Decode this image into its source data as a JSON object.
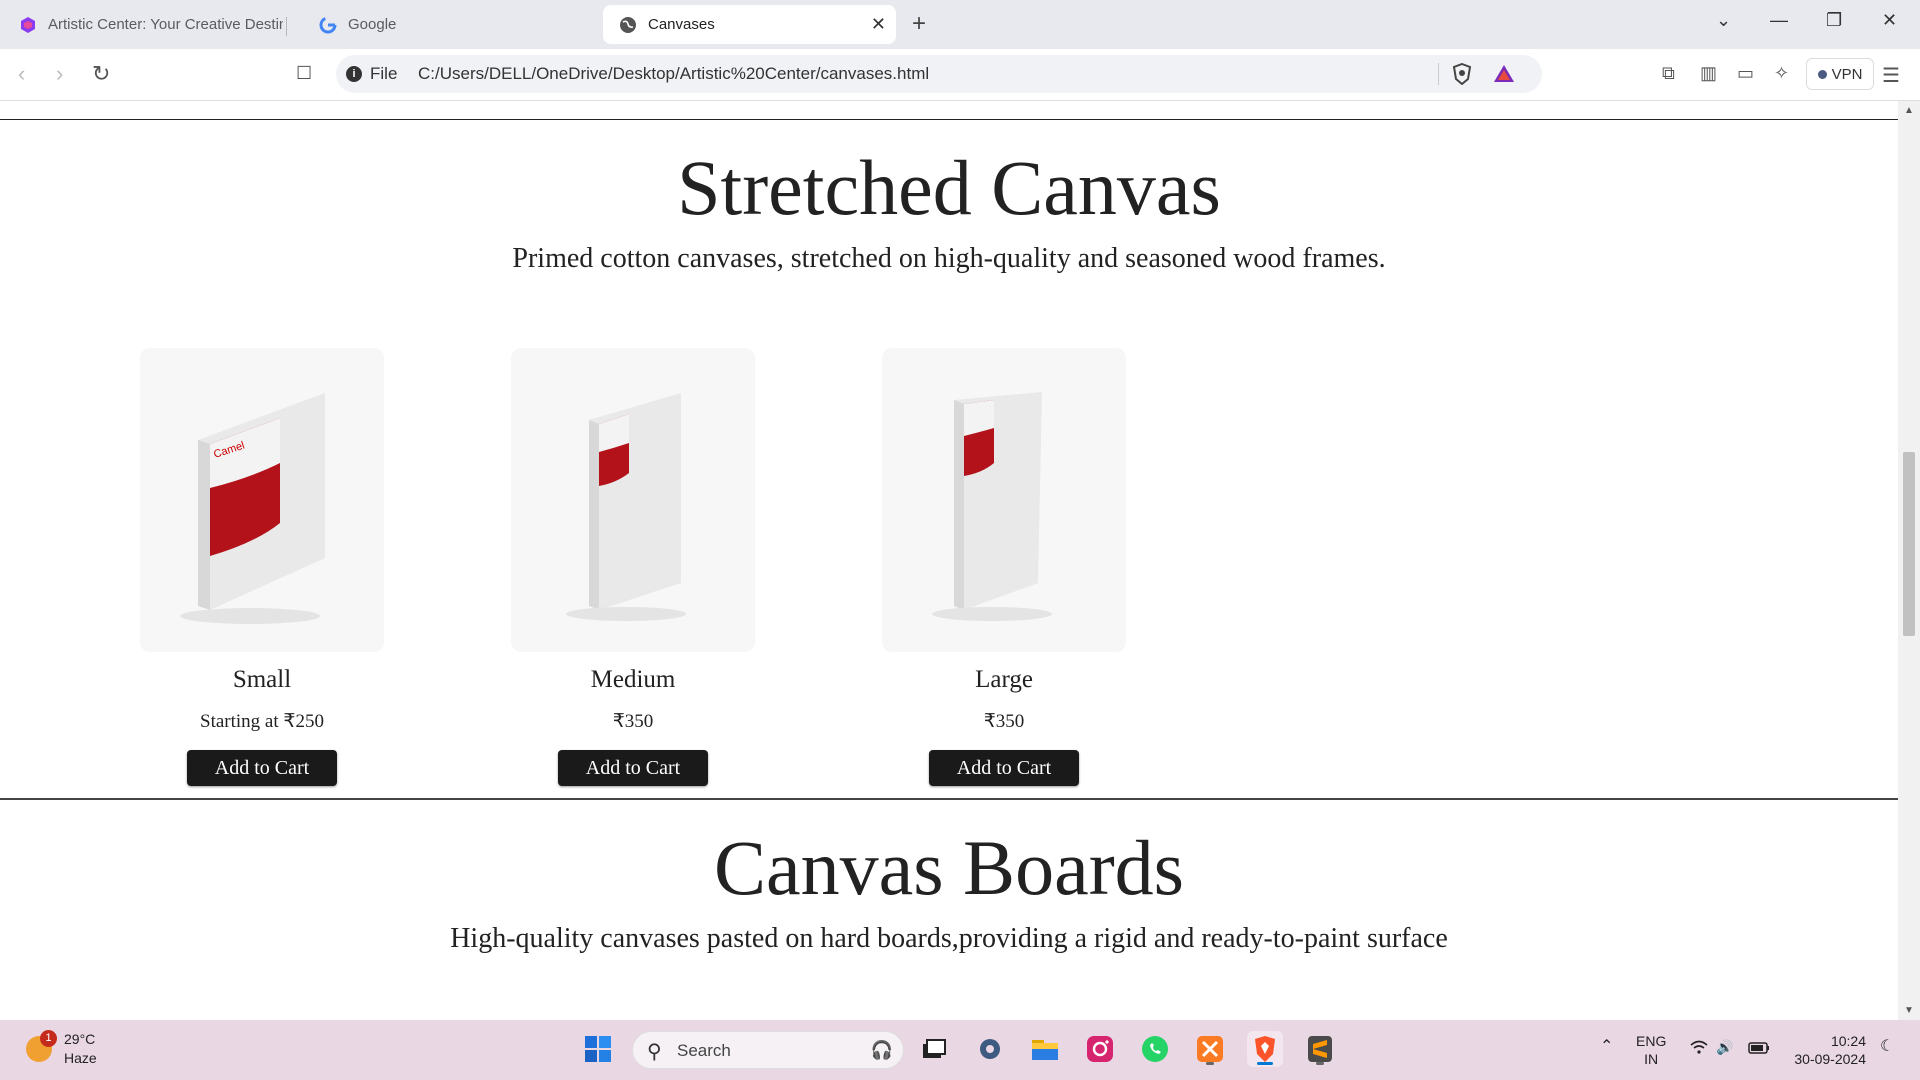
{
  "browser": {
    "tabs": [
      {
        "title": "Artistic Center: Your Creative Destin"
      },
      {
        "title": "Google"
      },
      {
        "title": "Canvases"
      }
    ],
    "address": {
      "scheme_label": "File",
      "url": "C:/Users/DELL/OneDrive/Desktop/Artistic%20Center/canvases.html"
    },
    "vpn_label": "VPN"
  },
  "page": {
    "section1": {
      "title": "Stretched Canvas",
      "subtitle": "Primed cotton canvases, stretched on high-quality and seasoned wood frames.",
      "products": [
        {
          "name": "Small",
          "price": "Starting at ₹250",
          "button": "Add to Cart"
        },
        {
          "name": "Medium",
          "price": "₹350",
          "button": "Add to Cart"
        },
        {
          "name": "Large",
          "price": "₹350",
          "button": "Add to Cart"
        }
      ]
    },
    "section2": {
      "title": "Canvas Boards",
      "subtitle": "High-quality canvases pasted on hard boards,providing a rigid and ready-to-paint surface"
    }
  },
  "taskbar": {
    "weather": {
      "temp": "29°C",
      "condition": "Haze",
      "badge": "1"
    },
    "search_label": "Search",
    "tray": {
      "lang": "ENG",
      "region": "IN",
      "time": "10:24",
      "date": "30-09-2024"
    }
  }
}
